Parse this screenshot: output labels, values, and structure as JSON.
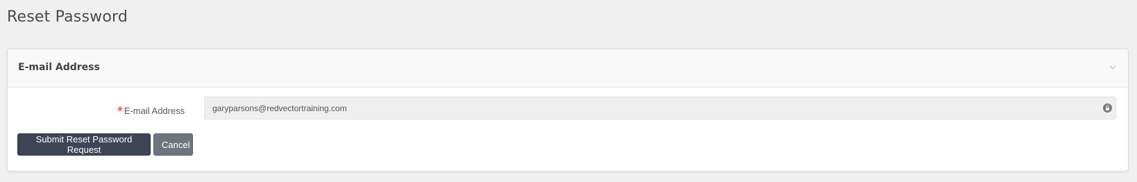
{
  "page": {
    "title": "Reset Password"
  },
  "card": {
    "header_title": "E-mail Address",
    "collapse_icon": "chevron-down-icon"
  },
  "form": {
    "email_label": "E-mail Address",
    "required_marker": "*",
    "email_value": "garyparsons@redvectortraining.com",
    "lock_icon": "lock-icon"
  },
  "actions": {
    "submit_label": "Submit Reset Password Request",
    "cancel_label": "Cancel"
  },
  "colors": {
    "background": "#f0f0f0",
    "submit_button": "#3e4557",
    "cancel_button": "#6d767e",
    "required": "#d9302c"
  }
}
